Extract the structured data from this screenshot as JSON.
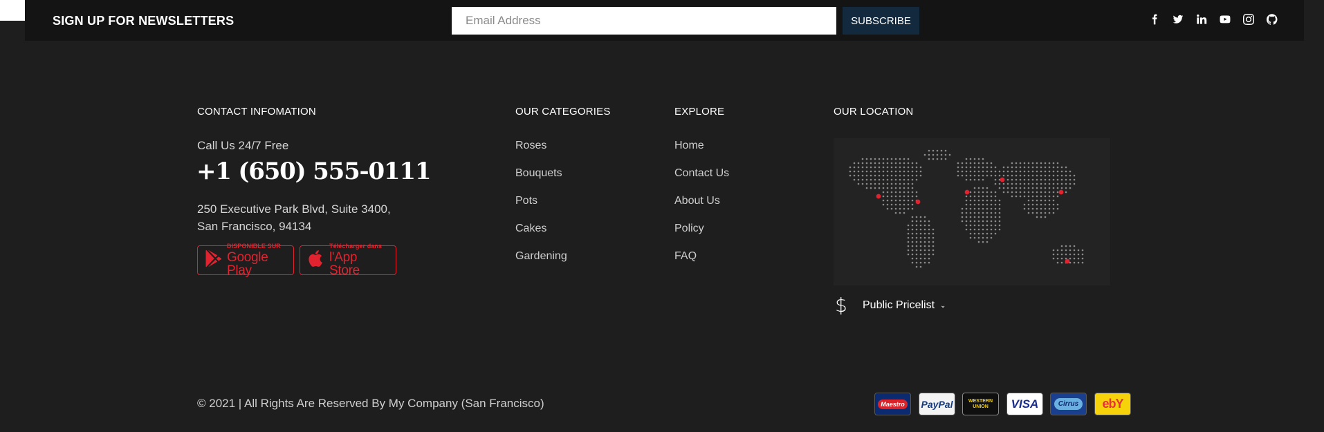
{
  "newsletter": {
    "title": "SIGN UP FOR NEWSLETTERS",
    "email_placeholder": "Email Address",
    "subscribe_label": "SUBSCRIBE"
  },
  "social_icons": [
    "facebook-icon",
    "twitter-icon",
    "linkedin-icon",
    "youtube-icon",
    "instagram-icon",
    "github-icon"
  ],
  "contact": {
    "heading": "CONTACT INFOMATION",
    "call_label": "Call Us 24/7 Free",
    "phone": "+1 (650) 555-0111",
    "address_line1": "250 Executive Park Blvd, Suite 3400,",
    "address_line2": "San Francisco, 94134",
    "google_play": {
      "small": "DISPONIBLE SUR",
      "big": "Google Play"
    },
    "app_store": {
      "small": "Télécharger dans",
      "big": "l'App Store"
    }
  },
  "categories": {
    "heading": "OUR CATEGORIES",
    "items": [
      "Roses",
      "Bouquets",
      "Pots",
      "Cakes",
      "Gardening"
    ]
  },
  "explore": {
    "heading": "EXPLORE",
    "items": [
      "Home",
      "Contact Us",
      "About Us",
      "Policy",
      "FAQ"
    ]
  },
  "location": {
    "heading": "OUR LOCATION",
    "pricelist_label": "Public Pricelist",
    "currency_icon": "dollar-icon"
  },
  "footer": {
    "copyright": "© 2021 | All Rights Are Reserved By My Company (San Francisco)"
  },
  "payments": {
    "maestro": "Maestro",
    "paypal": "PayPal",
    "western_union_line1": "WESTERN",
    "western_union_line2": "UNION",
    "visa": "VISA",
    "cirrus": "Cirrus",
    "ebay": "ebY"
  },
  "colors": {
    "background": "#1e1e1e",
    "newsletter_bar": "#141414",
    "subscribe_button": "#13293d",
    "accent_red": "#e0232f"
  }
}
